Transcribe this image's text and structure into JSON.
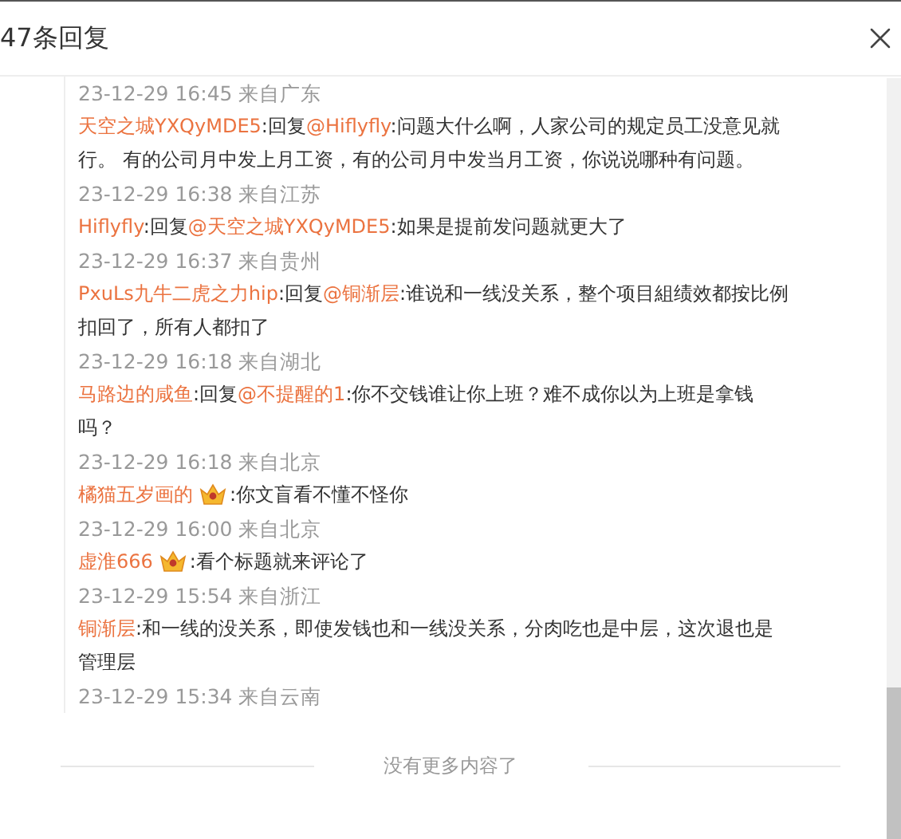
{
  "header": {
    "title": "47条回复"
  },
  "leading_time": "23-12-29 16:45 来自广东",
  "comments": [
    {
      "author": "天空之城YXQyMDE5",
      "reply_prefix": ":回复",
      "reply_to": "@Hiflyfly",
      "text": ":问题大什么啊，人家公司的规定员工没意见就行。 有的公司月中发上月工资，有的公司月中发当月工资，你说说哪种有问题。",
      "time": "23-12-29 16:38 来自江苏"
    },
    {
      "author": "Hiflyfly",
      "reply_prefix": ":回复",
      "reply_to": "@天空之城YXQyMDE5",
      "text": ":如果是提前发问题就更大了",
      "time": "23-12-29 16:37 来自贵州"
    },
    {
      "author": "PxuLs九牛二虎之力hip",
      "reply_prefix": ":回复",
      "reply_to": "@铜渐层",
      "text": ":谁说和一线没关系，整个项目組绩效都按比例扣回了，所有人都扣了",
      "time": "23-12-29 16:18 来自湖北"
    },
    {
      "author": "马路边的咸鱼",
      "reply_prefix": ":回复",
      "reply_to": "@不提醒的1",
      "text": ":你不交钱谁让你上班？难不成你以为上班是拿钱吗？",
      "time": "23-12-29 16:18 来自北京"
    },
    {
      "author": "橘猫五岁画的",
      "badge": true,
      "text": ":你文盲看不懂不怪你",
      "time": "23-12-29 16:00 来自北京"
    },
    {
      "author": "虚淮666",
      "badge": true,
      "text": ":看个标题就来评论了",
      "time": "23-12-29 15:54 来自浙江"
    },
    {
      "author": "铜渐层",
      "text": ":和一线的没关系，即使发钱也和一线没关系，分肉吃也是中层，这次退也是管理层",
      "time": "23-12-29 15:34 来自云南"
    }
  ],
  "footer": {
    "text": "没有更多内容了"
  }
}
